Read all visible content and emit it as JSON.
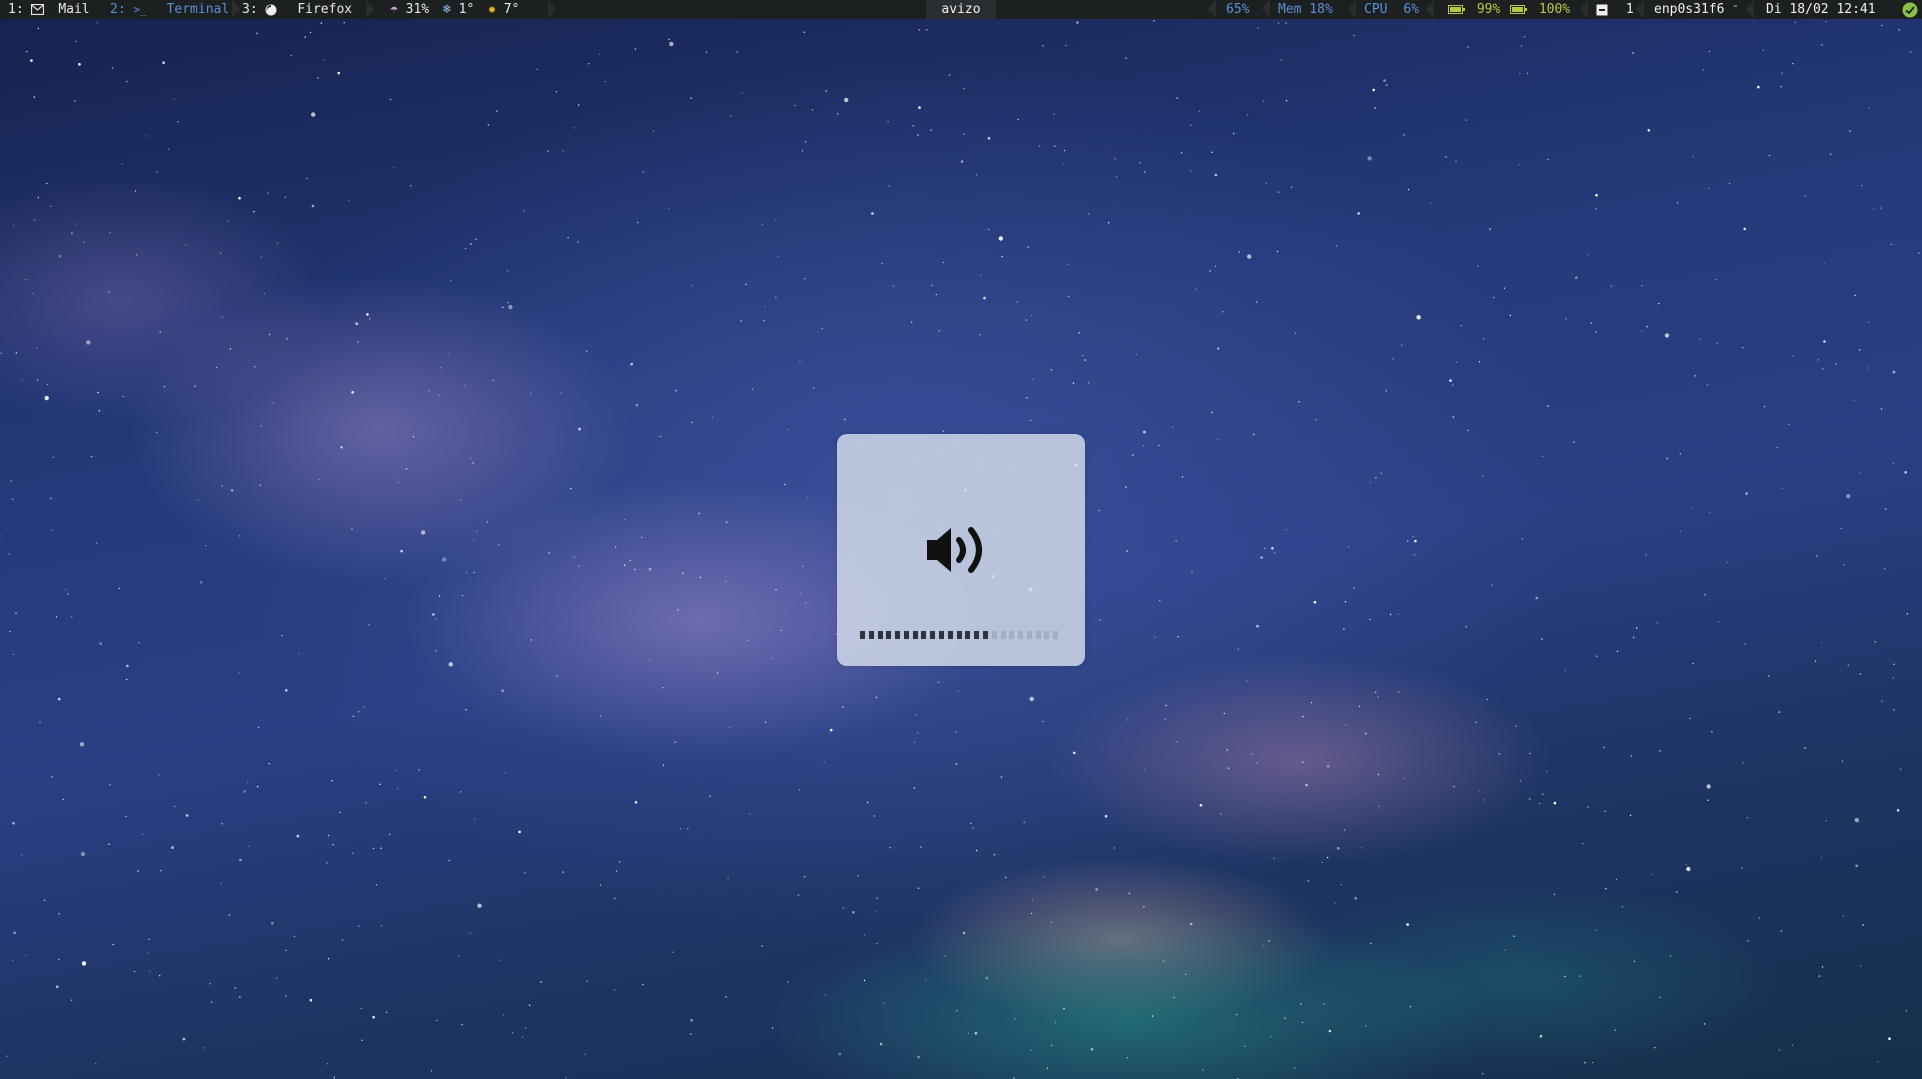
{
  "topbar": {
    "workspaces": [
      {
        "num": "1:",
        "label": "Mail",
        "icon": "mail-icon",
        "active": true
      },
      {
        "num": "2:",
        "label": "Terminal",
        "icon": "terminal-icon",
        "active": false
      },
      {
        "num": "3:",
        "label": "Firefox",
        "icon": "firefox-icon",
        "active": true
      }
    ],
    "weather": {
      "rain": "31%",
      "cold": "1°",
      "sun": "7°"
    },
    "window_title": "avizo",
    "status": {
      "volume": "65%",
      "mem": "Mem 18%",
      "cpu_label": "CPU",
      "cpu_value": "6%",
      "battery1": "99%",
      "battery2": "100%",
      "notifications": "1",
      "network": "enp0s31f6",
      "clock": "Di 18/02 12:41"
    },
    "colors": {
      "bar_bg": "#1d2021",
      "accent_blue": "#5b8fd6",
      "battery_green": "#b8c940"
    }
  },
  "osd": {
    "icon": "speaker-volume-icon",
    "level": 0.65,
    "segments_total": 23
  }
}
